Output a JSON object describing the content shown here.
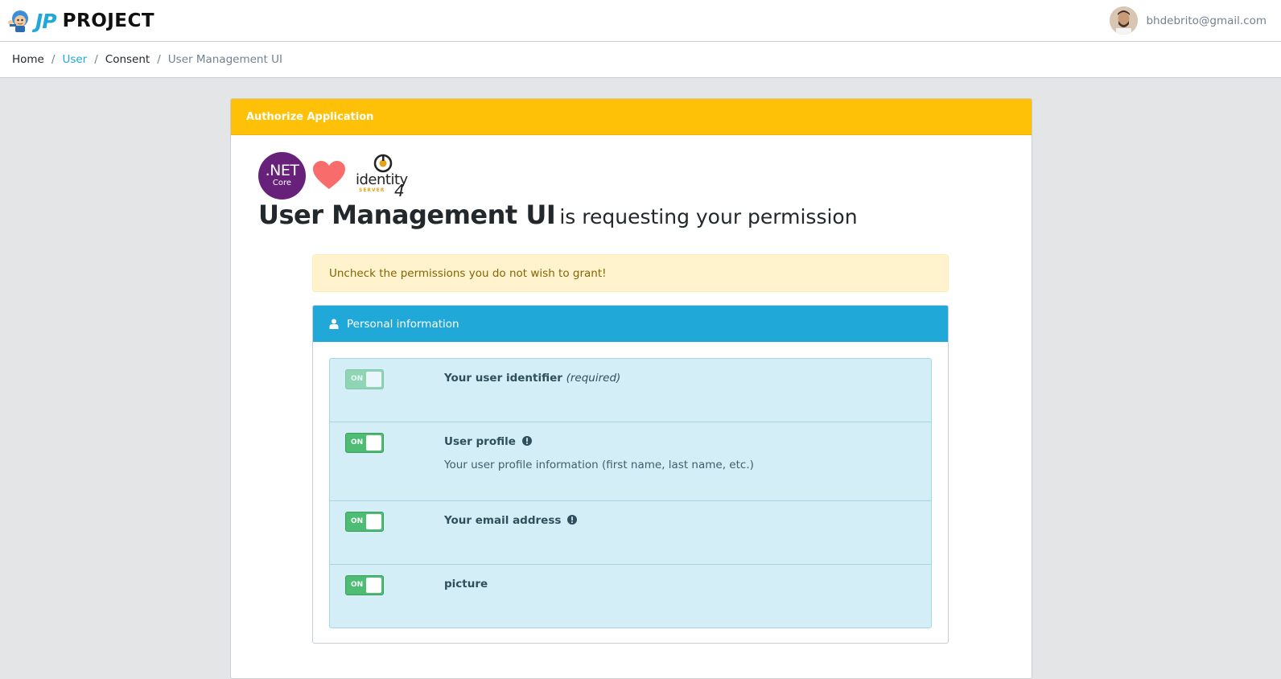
{
  "brand": {
    "jp": "JP",
    "project": "PROJECT"
  },
  "user": {
    "email": "bhdebrito@gmail.com"
  },
  "breadcrumb": {
    "home": "Home",
    "user": "User",
    "consent": "Consent",
    "current": "User Management UI",
    "separator": "/"
  },
  "card": {
    "header": "Authorize Application",
    "net_logo": {
      "title": ".NET",
      "subtitle": "Core"
    },
    "identity_logo": {
      "name": "identity",
      "server": "SERVER",
      "version": "4"
    },
    "app_name": "User Management UI",
    "request_text": "is requesting your permission"
  },
  "alert": {
    "text": "Uncheck the permissions you do not wish to grant!"
  },
  "panel": {
    "header": "Personal information",
    "items": [
      {
        "toggle": "ON",
        "title": "Your user identifier",
        "required": "(required)",
        "description": "",
        "disabled": true,
        "info": false
      },
      {
        "toggle": "ON",
        "title": "User profile",
        "required": "",
        "description": "Your user profile information (first name, last name, etc.)",
        "disabled": false,
        "info": true
      },
      {
        "toggle": "ON",
        "title": "Your email address",
        "required": "",
        "description": "",
        "disabled": false,
        "info": true
      },
      {
        "toggle": "ON",
        "title": "picture",
        "required": "",
        "description": "",
        "disabled": false,
        "info": false
      }
    ]
  },
  "colors": {
    "warning": "#ffc107",
    "info": "#20a8d8",
    "success": "#4dbd74",
    "alert_bg": "#fff3cd",
    "list_bg": "#d3eef7"
  }
}
